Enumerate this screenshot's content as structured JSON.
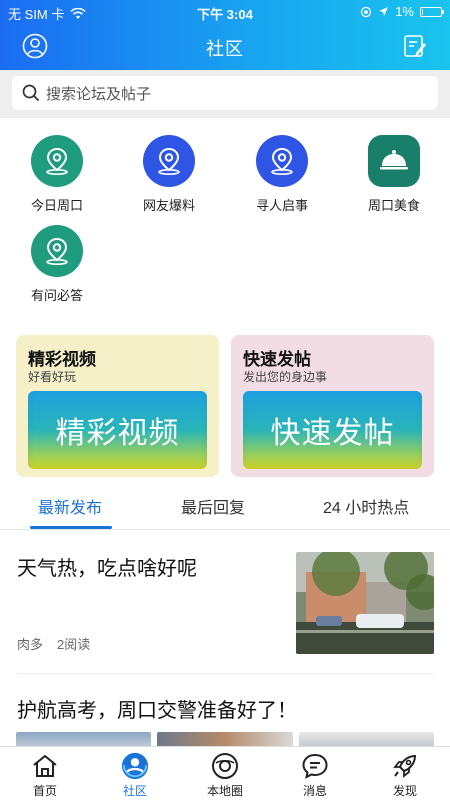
{
  "status_bar": {
    "carrier": "无 SIM 卡",
    "time": "下午 3:04",
    "battery": "1%"
  },
  "navbar": {
    "title": "社区"
  },
  "search": {
    "placeholder": "搜索论坛及帖子"
  },
  "grid_items": [
    {
      "label": "今日周口",
      "icon": "location-pin-icon",
      "color": "#1f9b7e"
    },
    {
      "label": "网友爆料",
      "icon": "location-pin-icon",
      "color": "#2f55e5"
    },
    {
      "label": "寻人启事",
      "icon": "location-pin-icon",
      "color": "#2f55e5"
    },
    {
      "label": "周口美食",
      "icon": "food-cloche-icon",
      "color": "#1a7f6a"
    },
    {
      "label": "有问必答",
      "icon": "location-pin-icon",
      "color": "#1f9b7e"
    }
  ],
  "cards": [
    {
      "title": "精彩视频",
      "subtitle": "好看好玩",
      "banner": "精彩视频",
      "bg": "#f5f0c8"
    },
    {
      "title": "快速发帖",
      "subtitle": "发出您的身边事",
      "banner": "快速发帖",
      "bg": "#f2dde4"
    }
  ],
  "tabs": [
    {
      "label": "最新发布",
      "active": true
    },
    {
      "label": "最后回复",
      "active": false
    },
    {
      "label": "24 小时热点",
      "active": false
    }
  ],
  "posts": [
    {
      "title": "天气热，吃点啥好呢",
      "author": "肉多",
      "reads": "2阅读"
    },
    {
      "title": "护航高考，周口交警准备好了！"
    }
  ],
  "bottom_nav": [
    {
      "label": "首页",
      "icon": "home-icon",
      "active": false
    },
    {
      "label": "社区",
      "icon": "community-icon",
      "active": true
    },
    {
      "label": "本地圈",
      "icon": "local-circle-icon",
      "active": false
    },
    {
      "label": "消息",
      "icon": "message-icon",
      "active": false
    },
    {
      "label": "发现",
      "icon": "rocket-icon",
      "active": false
    }
  ],
  "colors": {
    "accent": "#1a73d9",
    "header_start": "#1b6cf2",
    "header_end": "#19c4ee"
  }
}
